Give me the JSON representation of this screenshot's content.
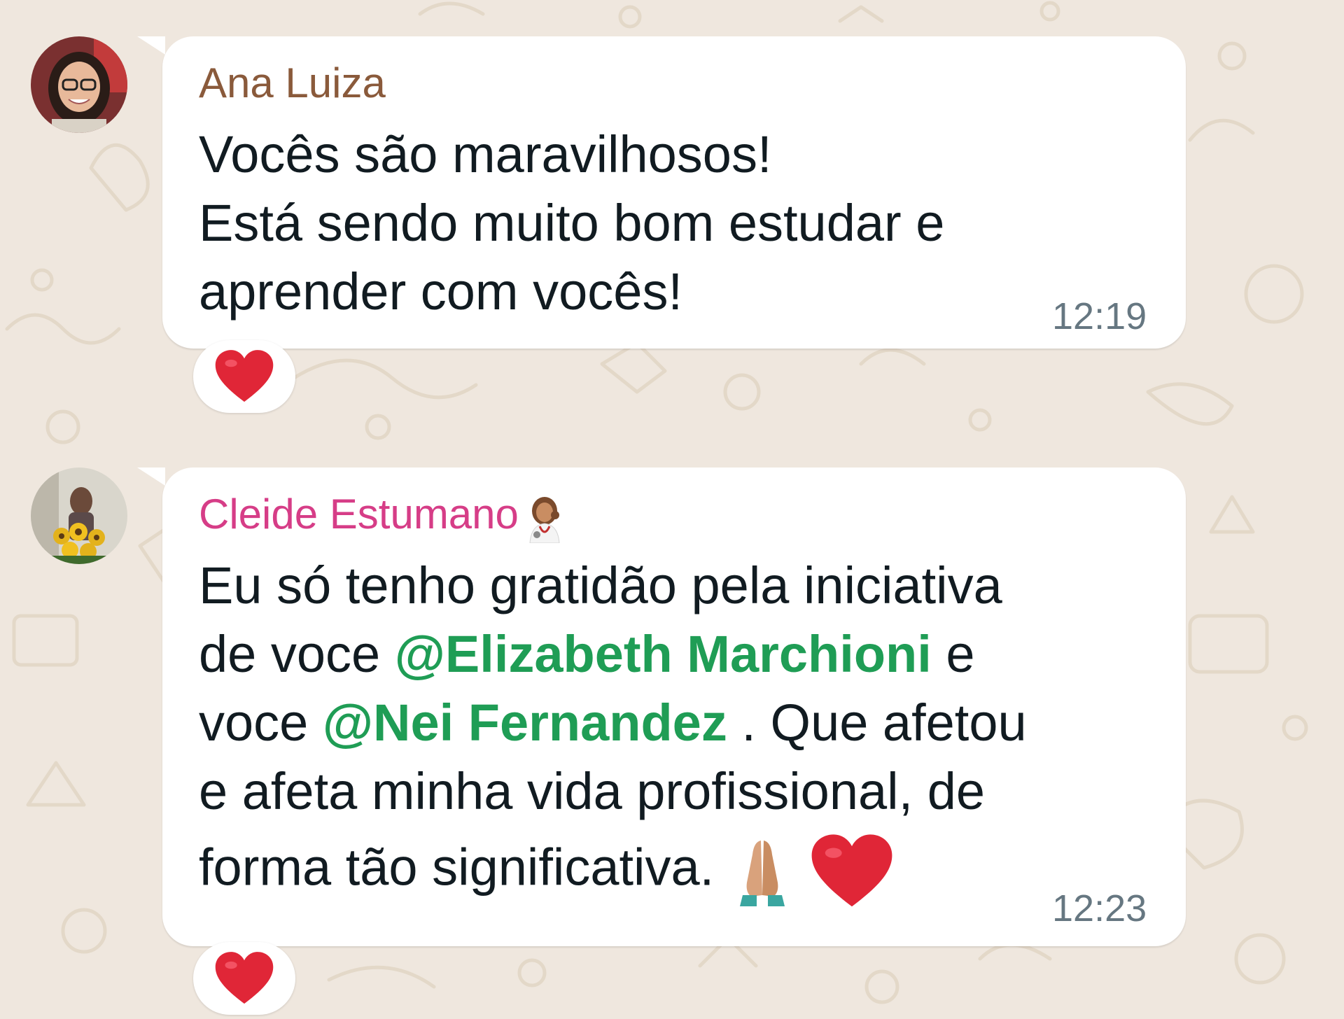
{
  "colors": {
    "wallpaper": "#efe7de",
    "bubble": "#ffffff",
    "sender_ana": "#8a5a3b",
    "sender_cleide": "#d63d87",
    "mention": "#1f9d55",
    "timestamp": "#667781",
    "heart": "#e02637"
  },
  "messages": [
    {
      "sender": "Ana Luiza",
      "lines": [
        "Vocês são maravilhosos!",
        "Está sendo muito bom estudar e",
        "aprender com vocês!"
      ],
      "time": "12:19",
      "reaction": "red-heart-icon"
    },
    {
      "sender": "Cleide Estumano",
      "sender_emoji": "health-worker-woman-icon",
      "line1": "Eu só tenho gratidão pela iniciativa",
      "line2_prefix": "de voce ",
      "mention1": "@Elizabeth Marchioni",
      "line2_suffix": "  e",
      "line3_prefix": "voce ",
      "mention2": "@Nei Fernandez",
      "line3_suffix": " . Que afetou",
      "line4": "e afeta minha vida profissional, de",
      "line5": "forma tão significativa.",
      "line5_emojis": [
        "folded-hands-icon",
        "red-heart-icon"
      ],
      "time": "12:23",
      "reaction": "red-heart-icon"
    }
  ]
}
